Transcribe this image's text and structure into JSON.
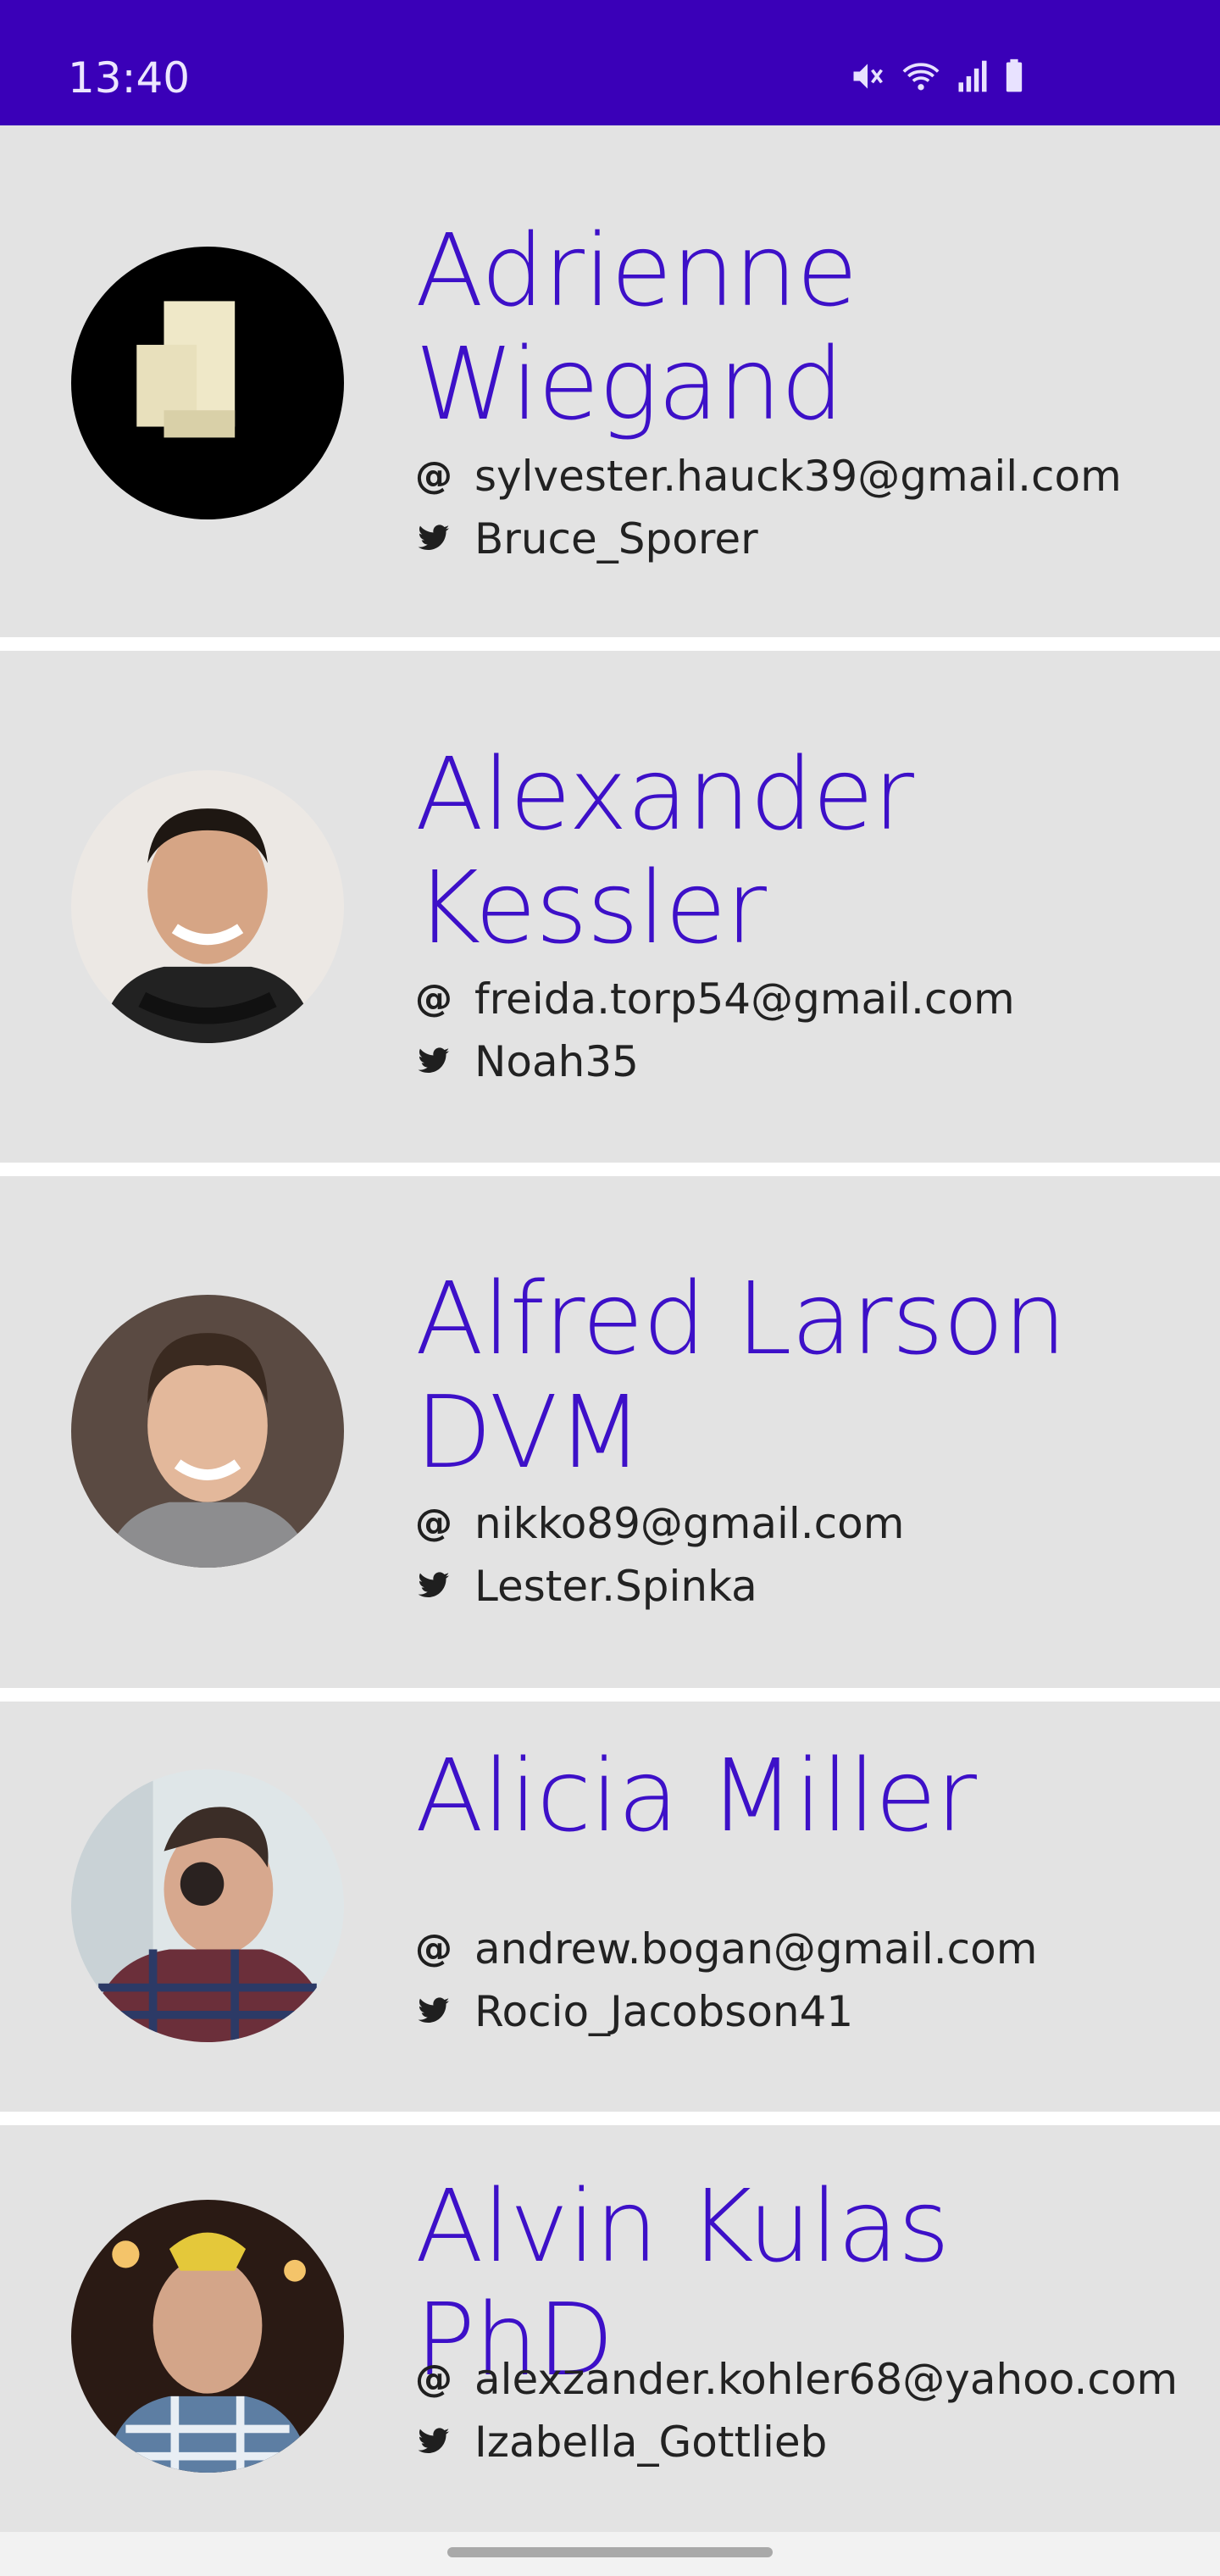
{
  "status_bar": {
    "time": "13:40",
    "icons": [
      "mute-icon",
      "wifi-icon",
      "signal-icon",
      "battery-icon"
    ]
  },
  "accent_color": "#3d10c8",
  "contacts": [
    {
      "name": "Adrienne Wiegand",
      "email": "sylvester.hauck39@gmail.com",
      "twitter": "Bruce_Sporer"
    },
    {
      "name": "Alexander Kessler",
      "email": "freida.torp54@gmail.com",
      "twitter": "Noah35"
    },
    {
      "name": "Alfred Larson DVM",
      "email": "nikko89@gmail.com",
      "twitter": "Lester.Spinka"
    },
    {
      "name": "Alicia Miller",
      "email": "andrew.bogan@gmail.com",
      "twitter": "Rocio_Jacobson41"
    },
    {
      "name": "Alvin Kulas PhD",
      "email": "alexzander.kohler68@yahoo.com",
      "twitter": "Izabella_Gottlieb"
    }
  ]
}
